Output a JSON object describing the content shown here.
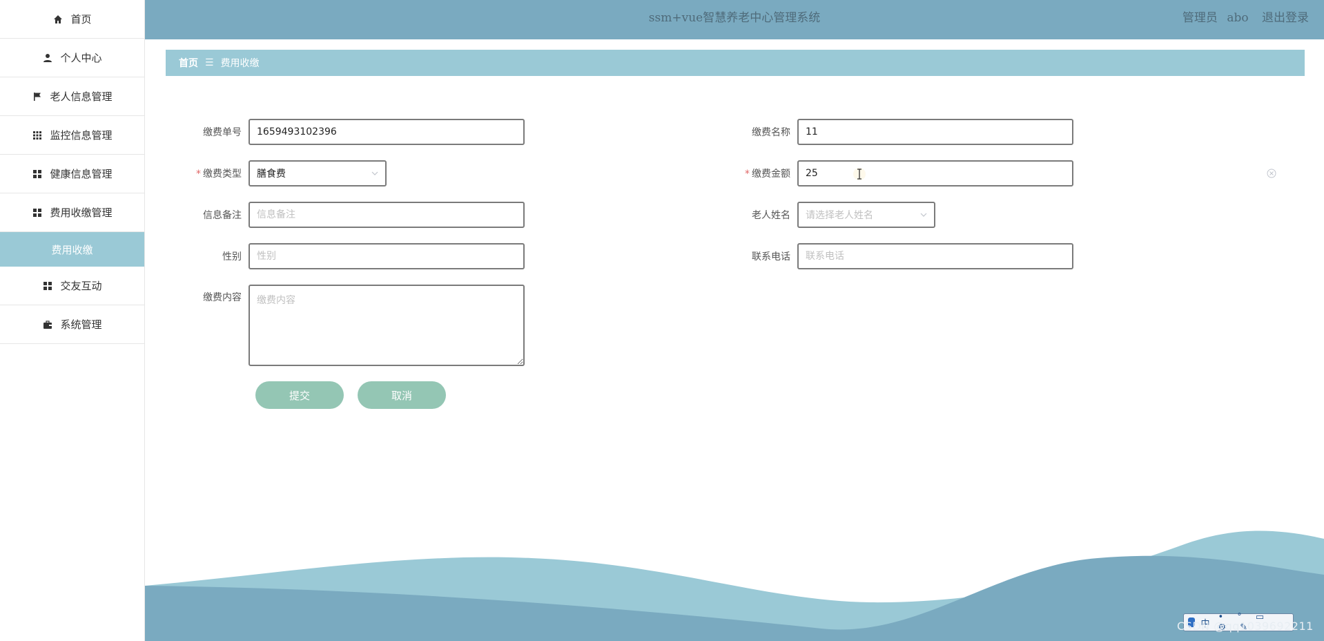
{
  "header": {
    "title": "ssm+vue智慧养老中心管理系统",
    "role": "管理员",
    "username": "abo",
    "logout": "退出登录"
  },
  "sidebar": {
    "items": [
      {
        "label": "首页",
        "icon": "home-icon"
      },
      {
        "label": "个人中心",
        "icon": "user-icon"
      },
      {
        "label": "老人信息管理",
        "icon": "flag-icon"
      },
      {
        "label": "监控信息管理",
        "icon": "grid-icon"
      },
      {
        "label": "健康信息管理",
        "icon": "apps-icon"
      },
      {
        "label": "费用收缴管理",
        "icon": "apps-icon"
      },
      {
        "label": "交友互动",
        "icon": "apps-icon"
      },
      {
        "label": "系统管理",
        "icon": "briefcase-icon"
      }
    ],
    "active_sub": "费用收缴"
  },
  "breadcrumb": {
    "home": "首页",
    "separator": "☰",
    "current": "费用收缴"
  },
  "form": {
    "bill_no": {
      "label": "缴费单号",
      "value": "1659493102396"
    },
    "bill_name": {
      "label": "缴费名称",
      "value": "11"
    },
    "bill_type": {
      "label": "缴费类型",
      "required": "*",
      "value": "膳食费"
    },
    "amount": {
      "label": "缴费金额",
      "required": "*",
      "value": "25"
    },
    "remark": {
      "label": "信息备注",
      "placeholder": "信息备注",
      "value": ""
    },
    "elder_name": {
      "label": "老人姓名",
      "placeholder": "请选择老人姓名"
    },
    "gender": {
      "label": "性别",
      "placeholder": "性别",
      "value": ""
    },
    "phone": {
      "label": "联系电话",
      "placeholder": "联系电话",
      "value": ""
    },
    "content": {
      "label": "缴费内容",
      "placeholder": "缴费内容",
      "value": ""
    },
    "submit": "提交",
    "cancel": "取消"
  },
  "ime": {
    "text": "中"
  },
  "watermark": "CSDN @qq1039692211",
  "colors": {
    "header": "#7aaac0",
    "breadcrumb": "#9ac9d6",
    "button": "#94c6b4",
    "wave_light": "#9ac9d6",
    "wave_dark": "#7aaac0"
  }
}
